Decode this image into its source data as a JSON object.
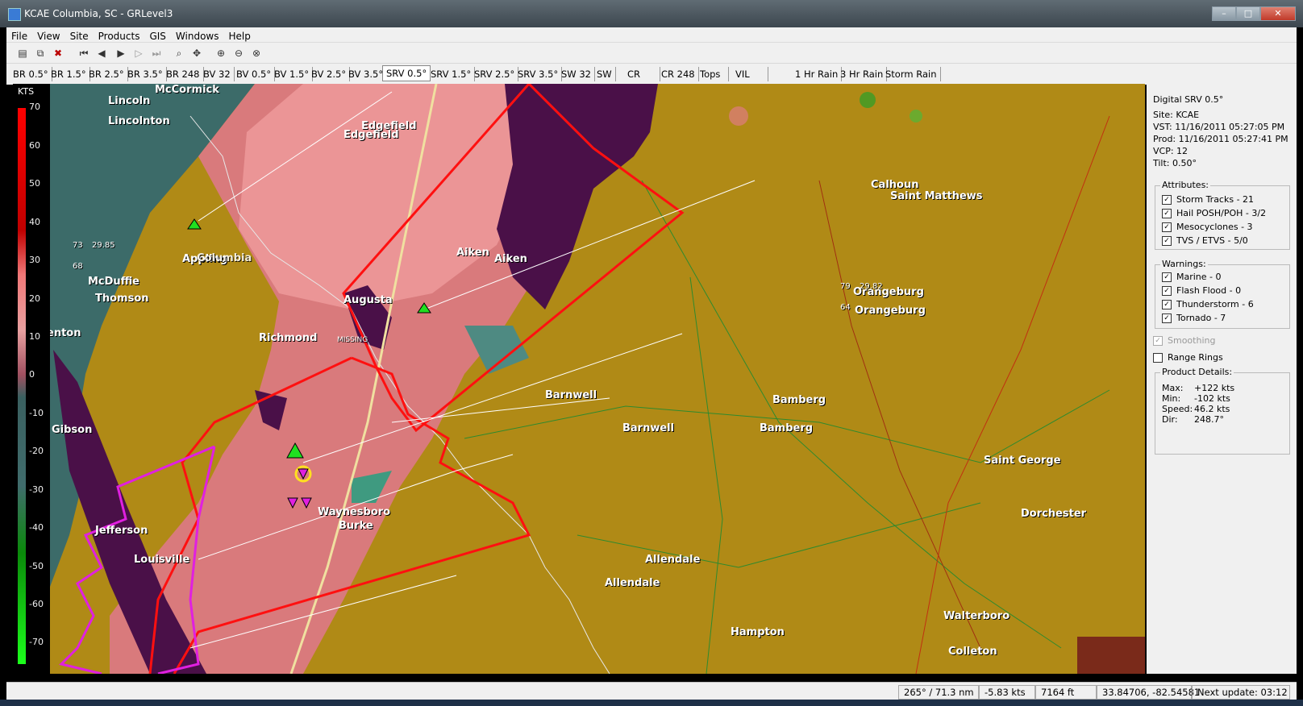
{
  "window": {
    "title": "KCAE Columbia, SC - GRLevel3",
    "min": "–",
    "max": "□",
    "close": "✕"
  },
  "menu": [
    "File",
    "View",
    "Site",
    "Products",
    "GIS",
    "Windows",
    "Help"
  ],
  "tabs": [
    "BR 0.5°",
    "BR 1.5°",
    "BR 2.5°",
    "BR 3.5°",
    "BR 248",
    "BV 32",
    "BV 0.5°",
    "BV 1.5°",
    "BV 2.5°",
    "BV 3.5°",
    "SRV 0.5°",
    "SRV 1.5°",
    "SRV 2.5°",
    "SRV 3.5°",
    "SW 32",
    "SW",
    "CR",
    "CR 248",
    "Tops",
    "VIL",
    "1 Hr Rain",
    "3 Hr Rain",
    "Storm Rain"
  ],
  "active_tab": "SRV 0.5°",
  "legend": {
    "unit": "KTS",
    "ticks": [
      "70",
      "60",
      "50",
      "40",
      "30",
      "20",
      "10",
      "0",
      "-10",
      "-20",
      "-30",
      "-40",
      "-50",
      "-60",
      "-70"
    ]
  },
  "info": {
    "product": "Digital SRV 0.5°",
    "site_label": "Site:",
    "site": "KCAE",
    "vst_label": "VST:",
    "vst": "11/16/2011  05:27:05 PM",
    "prod_label": "Prod:",
    "prod": "11/16/2011  05:27:41 PM",
    "vcp_label": "VCP:",
    "vcp": "12",
    "tilt_label": "Tilt:",
    "tilt": "0.50°"
  },
  "attributes": {
    "title": "Attributes:",
    "items": [
      "Storm Tracks - 21",
      "Hail POSH/POH - 3/2",
      "Mesocyclones - 3",
      "TVS / ETVS - 5/0"
    ]
  },
  "warnings": {
    "title": "Warnings:",
    "items": [
      "Marine - 0",
      "Flash Flood - 0",
      "Thunderstorm - 6",
      "Tornado - 7"
    ]
  },
  "options": {
    "smoothing": "Smoothing",
    "range_rings": "Range Rings"
  },
  "details": {
    "title": "Product Details:",
    "max_label": "Max:",
    "max": "+122 kts",
    "min_label": "Min:",
    "min": "-102 kts",
    "speed_label": "Speed:",
    "speed": "46.2 kts",
    "dir_label": "Dir:",
    "dir": "248.7°"
  },
  "status": {
    "bearing": "265° / 71.3 nm",
    "velocity": "-5.83 kts",
    "height": "7164 ft",
    "coords": "33.84706, -82.54581",
    "next_update": "Next update: 03:12"
  },
  "cities": [
    "McCormick",
    "Lincoln",
    "Lincolnton",
    "Edgefield",
    "Edgefield",
    "Calhoun",
    "Saint Matthews",
    "Aiken",
    "Aiken",
    "Appling",
    "Columbia",
    "McDuffie",
    "Thomson",
    "Augusta",
    "Orangeburg",
    "Orangeburg",
    "Richmond",
    "MISSING",
    "enton",
    "Barnwell",
    "Barnwell",
    "Bamberg",
    "Bamberg",
    "Gibson",
    "Saint George",
    "Waynesboro",
    "Burke",
    "Dorchester",
    "Jefferson",
    "Louisville",
    "Allendale",
    "Allendale",
    "Walterboro",
    "Hampton",
    "Colleton"
  ],
  "stations": [
    "73",
    "29.85",
    "68",
    "79",
    "29.82",
    "64"
  ],
  "colors": {
    "ground": "#b08a16",
    "inbound": "#3c6b69",
    "outbound": "#e07c80",
    "tornado_warning": "#ff1010",
    "thunderstorm_warning": "#e020e0"
  }
}
